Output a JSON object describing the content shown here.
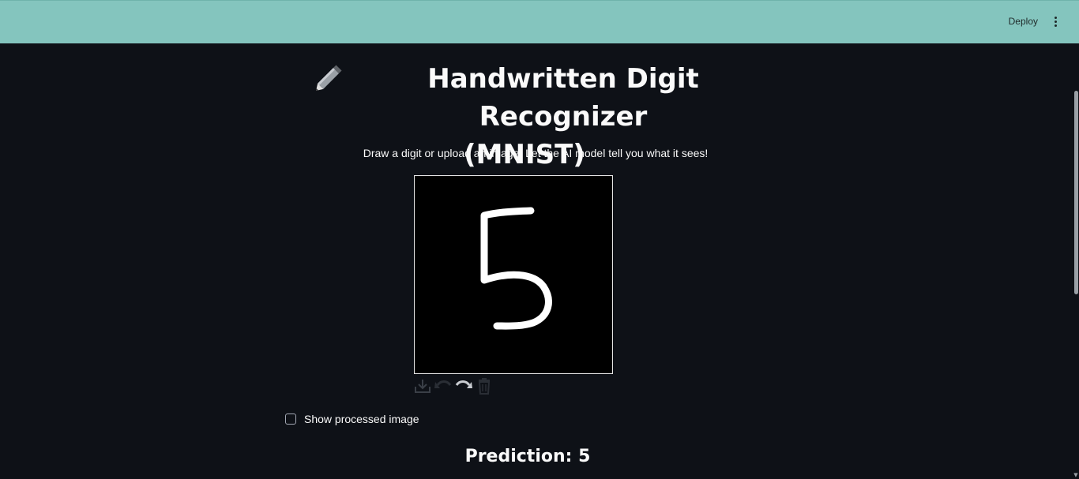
{
  "header": {
    "deploy_label": "Deploy",
    "menu_icon": "kebab-menu-icon",
    "background": "#84c5be"
  },
  "main": {
    "title_emoji": "pencil-icon",
    "title_line1": "Handwritten Digit Recognizer",
    "title_line2": "(MNIST)",
    "subtitle": "Draw a digit or upload an image. Let the AI model tell you what it sees!",
    "canvas": {
      "drawn_digit": "5",
      "background": "#000000",
      "stroke": "#ffffff"
    },
    "toolbar": [
      "download-icon",
      "undo-icon",
      "redo-icon",
      "trash-icon"
    ],
    "checkbox": {
      "label": "Show processed image",
      "checked": false
    },
    "prediction": "Prediction: 5"
  }
}
